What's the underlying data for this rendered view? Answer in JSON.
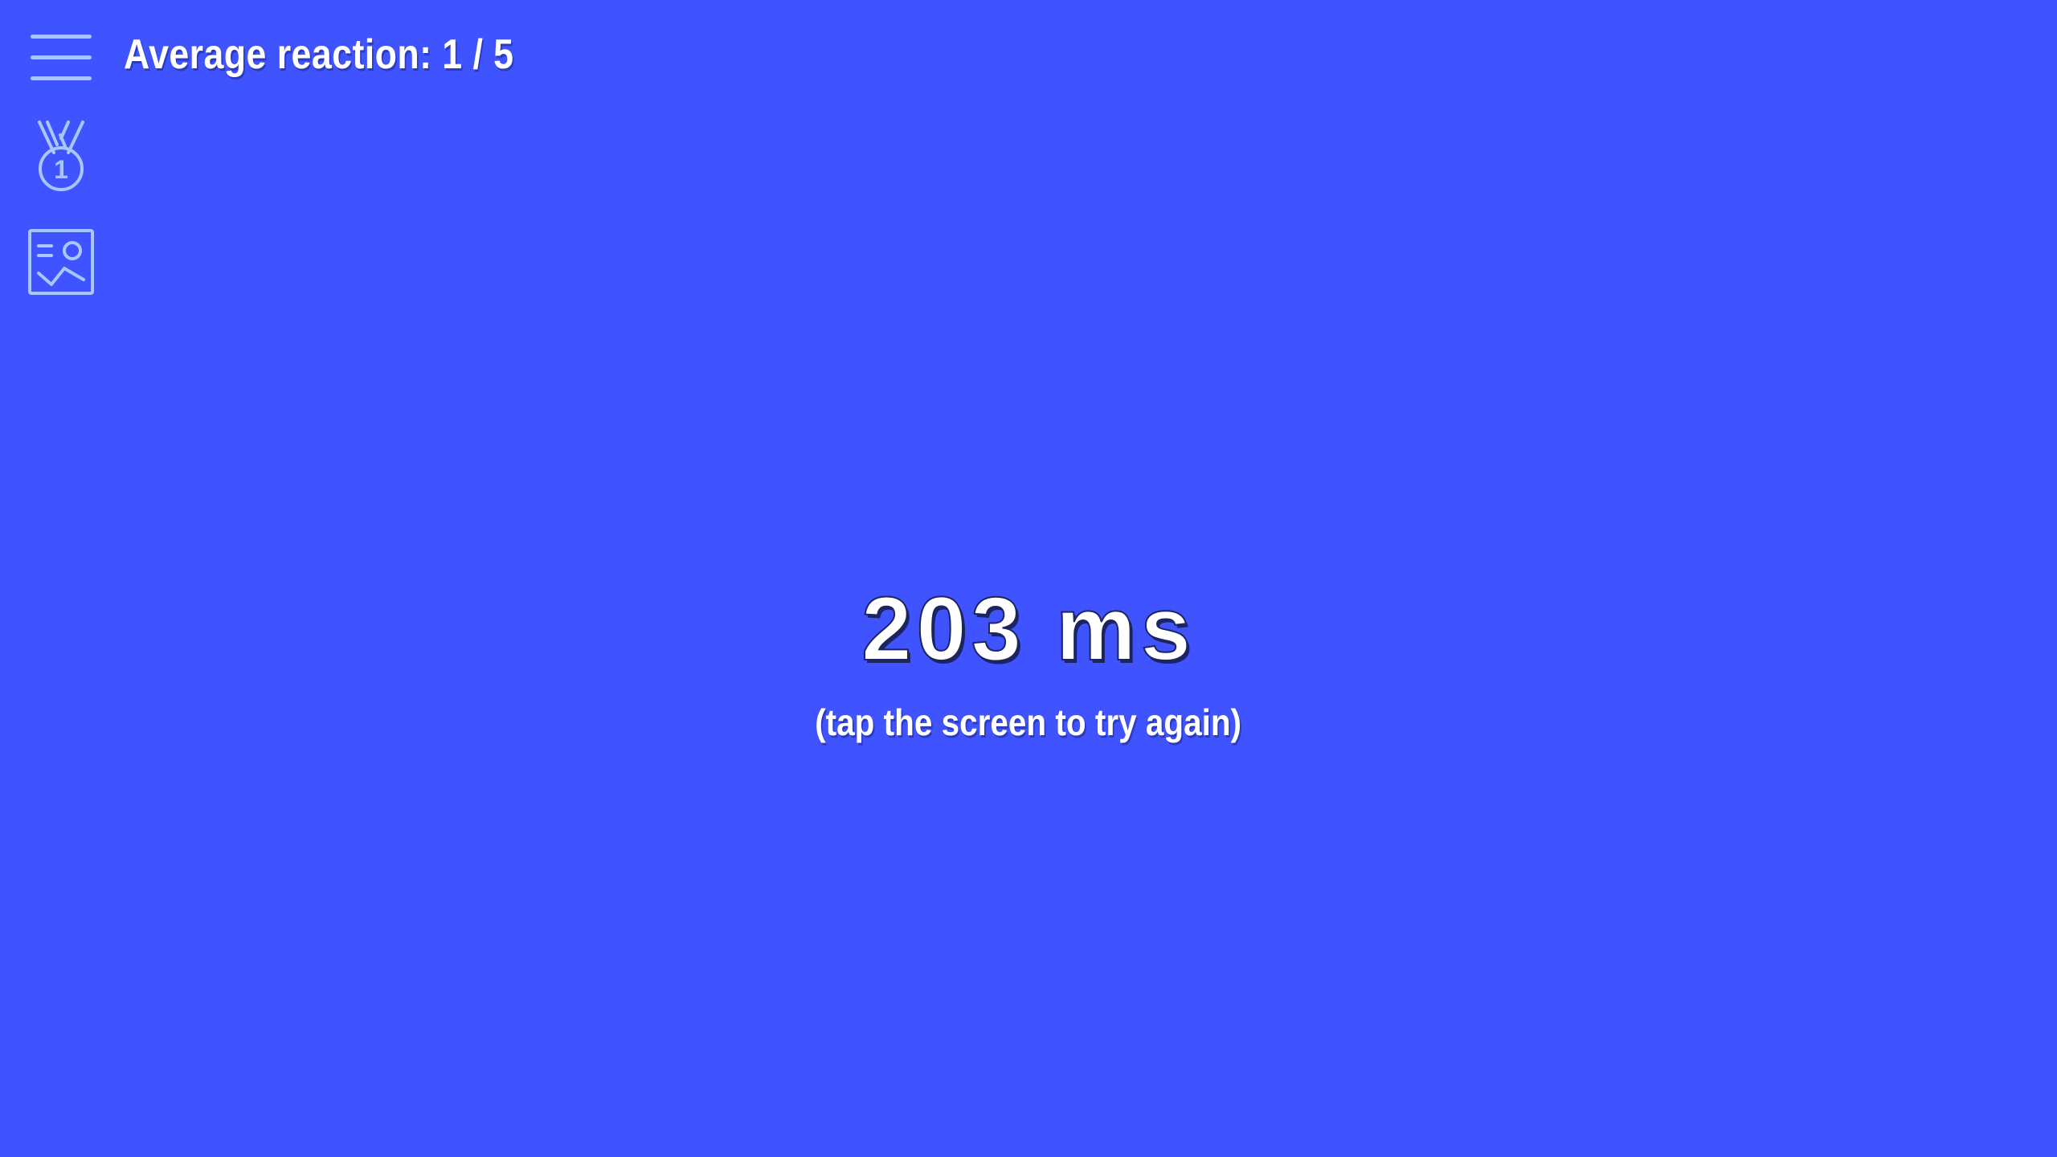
{
  "header": {
    "title": "Average reaction: 1 / 5"
  },
  "sidebar": {
    "icons": [
      "menu-icon",
      "medal-icon",
      "gallery-icon"
    ],
    "medal_number": "1"
  },
  "result": {
    "value": "203 ms",
    "hint": "(tap the screen to try again)"
  },
  "colors": {
    "background": "#3f53fe",
    "text": "#ffffff",
    "icon": "#a9c7ff"
  }
}
